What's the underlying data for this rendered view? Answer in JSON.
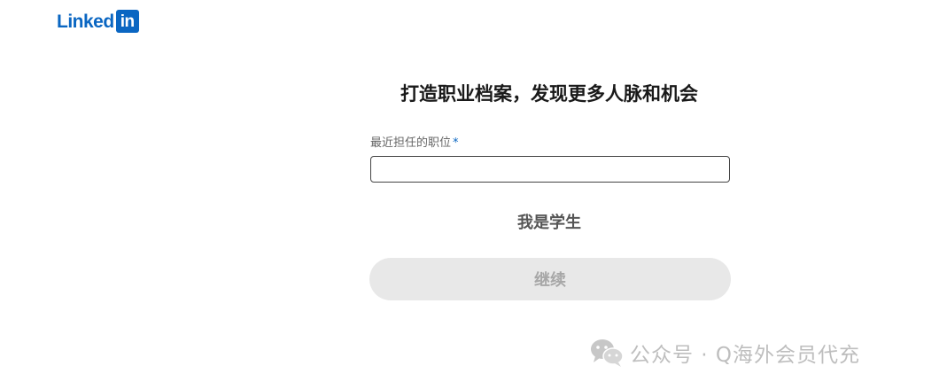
{
  "brand": {
    "logo_word": "Linked",
    "logo_box": "in",
    "color": "#0a66c2"
  },
  "page": {
    "title": "打造职业档案，发现更多人脉和机会"
  },
  "form": {
    "position_label": "最近担任的职位",
    "required_mark": "*",
    "position_value": ""
  },
  "actions": {
    "student_link": "我是学生",
    "continue_label": "继续"
  },
  "watermark": {
    "icon": "wechat-icon",
    "text": "公众号 · Q海外会员代充"
  },
  "colors": {
    "accent": "#0a66c2",
    "button_disabled_bg": "#e8e8e8",
    "button_disabled_text": "#a7a7a7"
  }
}
